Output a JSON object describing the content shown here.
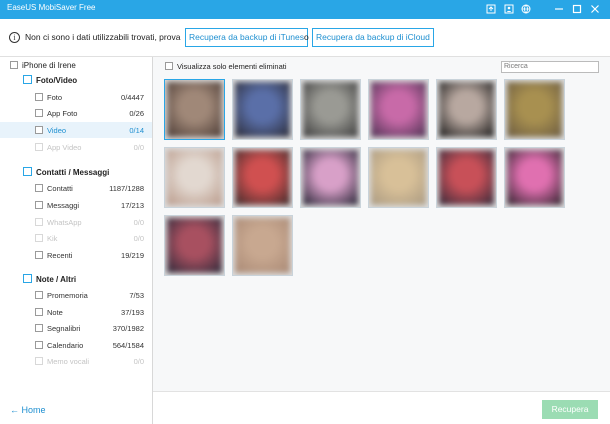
{
  "window": {
    "title": "EaseUS MobiSaver Free"
  },
  "infobar": {
    "message": "Non ci sono i dati utilizzabili trovati, prova",
    "itunes_button": "Recupera da backup di iTunes",
    "or_text": "o",
    "icloud_button": "Recupera da backup di iCloud"
  },
  "sidebar": {
    "device": "iPhone di Irene",
    "groups": [
      {
        "label": "Foto/Video",
        "icon": "photo-icon",
        "items": [
          {
            "label": "Foto",
            "count": "0/4447",
            "enabled": true,
            "selected": false
          },
          {
            "label": "App Foto",
            "count": "0/26",
            "enabled": true,
            "selected": false
          },
          {
            "label": "Video",
            "count": "0/14",
            "enabled": true,
            "selected": true
          },
          {
            "label": "App Video",
            "count": "0/0",
            "enabled": false,
            "selected": false
          }
        ]
      },
      {
        "label": "Contatti / Messaggi",
        "icon": "contacts-icon",
        "items": [
          {
            "label": "Contatti",
            "count": "1187/1288",
            "enabled": true,
            "selected": false
          },
          {
            "label": "Messaggi",
            "count": "17/213",
            "enabled": true,
            "selected": false
          },
          {
            "label": "WhatsApp",
            "count": "0/0",
            "enabled": false,
            "selected": false
          },
          {
            "label": "Kik",
            "count": "0/0",
            "enabled": false,
            "selected": false
          },
          {
            "label": "Recenti",
            "count": "19/219",
            "enabled": true,
            "selected": false
          }
        ]
      },
      {
        "label": "Note / Altri",
        "icon": "notes-icon",
        "items": [
          {
            "label": "Promemoria",
            "count": "7/53",
            "enabled": true,
            "selected": false
          },
          {
            "label": "Note",
            "count": "37/193",
            "enabled": true,
            "selected": false
          },
          {
            "label": "Segnalibri",
            "count": "370/1982",
            "enabled": true,
            "selected": false
          },
          {
            "label": "Calendario",
            "count": "564/1584",
            "enabled": true,
            "selected": false
          },
          {
            "label": "Memo vocali",
            "count": "0/0",
            "enabled": false,
            "selected": false
          }
        ]
      }
    ],
    "home_label": "Home"
  },
  "main": {
    "filter_label": "Visualizza solo elementi eliminati",
    "search_placeholder": "Ricerca",
    "thumbnails": [
      {
        "c1": "#a08878",
        "c2": "#4a3a34",
        "selected": true
      },
      {
        "c1": "#5a6fa8",
        "c2": "#2a2a35",
        "selected": false
      },
      {
        "c1": "#9a9a94",
        "c2": "#3a3a3a",
        "selected": false
      },
      {
        "c1": "#c86aa8",
        "c2": "#4a3050",
        "selected": false
      },
      {
        "c1": "#b8a8a0",
        "c2": "#151515",
        "selected": false
      },
      {
        "c1": "#a89050",
        "c2": "#6a5a40",
        "selected": false
      },
      {
        "c1": "#e2d8d0",
        "c2": "#b89888",
        "selected": false
      },
      {
        "c1": "#d05050",
        "c2": "#3a2a2a",
        "selected": false
      },
      {
        "c1": "#d8a0c8",
        "c2": "#202030",
        "selected": false
      },
      {
        "c1": "#d8c098",
        "c2": "#a89880",
        "selected": false
      },
      {
        "c1": "#c85058",
        "c2": "#302838",
        "selected": false
      },
      {
        "c1": "#e070b0",
        "c2": "#2a2028",
        "selected": false
      },
      {
        "c1": "#a85060",
        "c2": "#2a2838",
        "selected": false
      },
      {
        "c1": "#c8a890",
        "c2": "#a88874",
        "selected": false
      }
    ]
  },
  "footer": {
    "recover_button": "Recupera"
  },
  "colors": {
    "accent": "#29a6e6",
    "link": "#1e8fd0",
    "recover_disabled": "#9bdcb3"
  }
}
